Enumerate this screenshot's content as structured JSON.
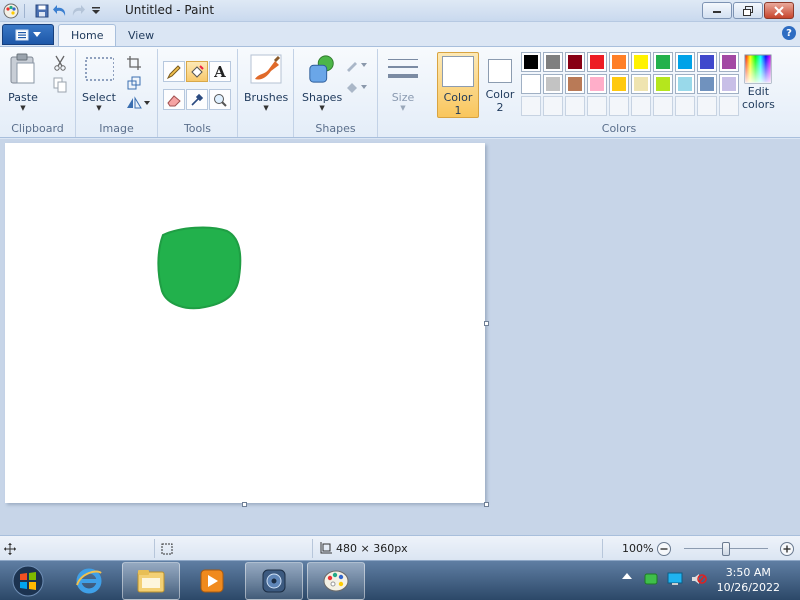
{
  "window": {
    "title": "Untitled - Paint"
  },
  "tabs": [
    {
      "label": "Home",
      "active": true
    },
    {
      "label": "View",
      "active": false
    }
  ],
  "ribbon": {
    "groups": {
      "clipboard": "Clipboard",
      "image": "Image",
      "tools": "Tools",
      "shapes": "Shapes",
      "colors": "Colors"
    },
    "buttons": {
      "paste": "Paste",
      "select": "Select",
      "brushes": "Brushes",
      "shapes": "Shapes",
      "size": "Size",
      "color1_line1": "Color",
      "color1_line2": "1",
      "color2_line1": "Color",
      "color2_line2": "2",
      "edit_colors_line1": "Edit",
      "edit_colors_line2": "colors"
    },
    "palette": [
      "#000000",
      "#7f7f7f",
      "#880015",
      "#ed1c24",
      "#ff7f27",
      "#fff200",
      "#22b14c",
      "#00a2e8",
      "#3f48cc",
      "#a349a4",
      "#ffffff",
      "#c3c3c3",
      "#b97a57",
      "#ffaec9",
      "#ffc90e",
      "#efe4b0",
      "#b5e61d",
      "#99d9ea",
      "#7092be",
      "#c8bfe7"
    ],
    "empty_slots": 10
  },
  "canvas": {
    "width": 480,
    "height": 360,
    "shape_color": "#22b14c"
  },
  "status": {
    "dimensions": "480 × 360px",
    "zoom": "100%"
  },
  "taskbar": {
    "time": "3:50 AM",
    "date": "10/26/2022"
  },
  "colors": {
    "accent": "#1d57a8",
    "selected": "#f8c96c"
  }
}
